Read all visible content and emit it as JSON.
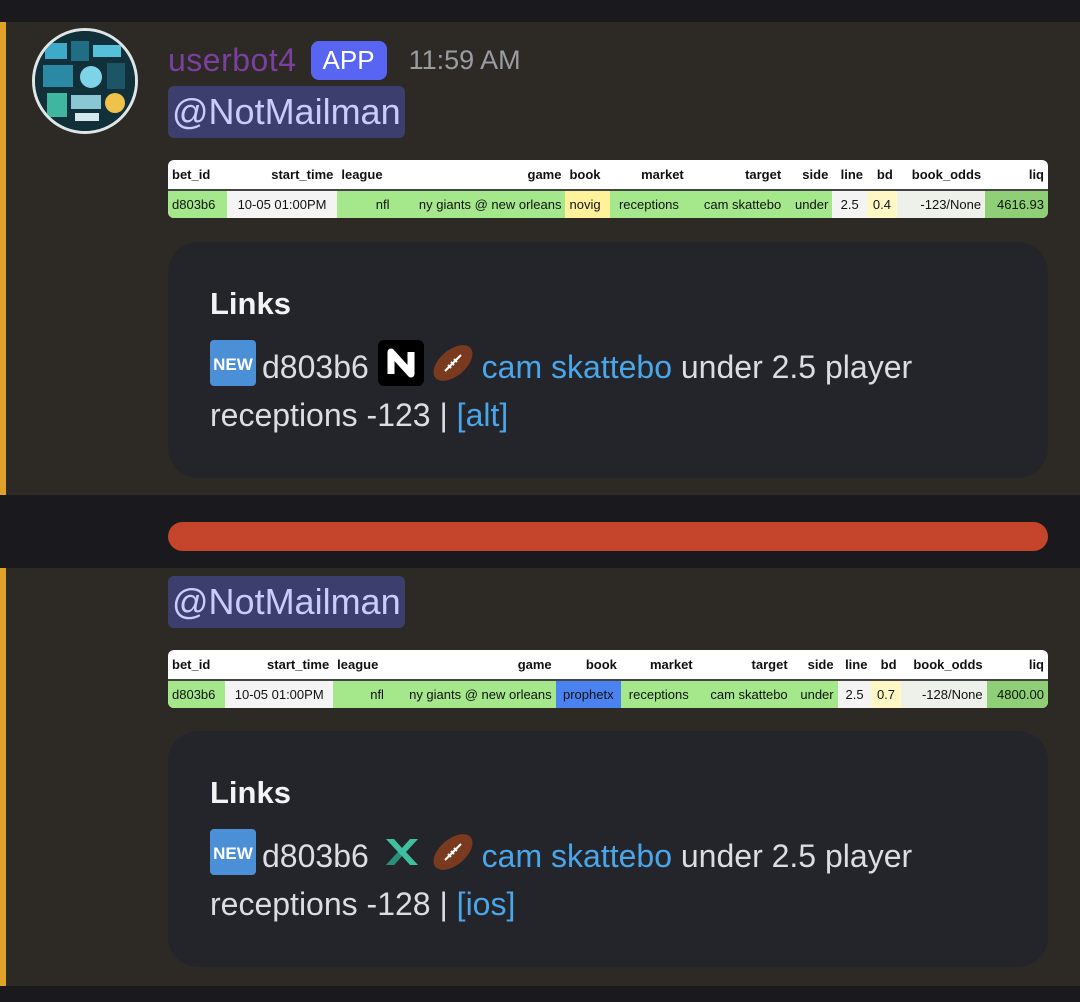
{
  "message1": {
    "username": "userbot4",
    "badge": "APP",
    "timestamp": "11:59 AM",
    "mention": "@NotMailman",
    "table": {
      "headers": [
        "bet_id",
        "start_time",
        "league",
        "game",
        "book",
        "market",
        "target",
        "side",
        "line",
        "bd",
        "book_odds",
        "liq"
      ],
      "row": [
        "d803b6",
        "10-05 01:00PM",
        "nfl",
        "ny giants @ new orleans",
        "novig",
        "receptions",
        "cam skattebo",
        "under",
        "2.5",
        "0.4",
        "-123/None",
        "4616.93"
      ]
    },
    "embed": {
      "title": "Links",
      "new_icon": "new-emoji-icon",
      "bet_id": "d803b6",
      "book_icon": "novig-logo-icon",
      "sport_icon": "american-football-icon",
      "player_link": "cam skattebo",
      "text1": " under 2.5 player",
      "text2": "receptions -123 | ",
      "alt_link": "[alt]"
    }
  },
  "divider_color": "#c4442c",
  "message2": {
    "mention": "@NotMailman",
    "table": {
      "headers": [
        "bet_id",
        "start_time",
        "league",
        "game",
        "book",
        "market",
        "target",
        "side",
        "line",
        "bd",
        "book_odds",
        "liq"
      ],
      "row": [
        "d803b6",
        "10-05 01:00PM",
        "nfl",
        "ny giants @ new orleans",
        "prophetx",
        "receptions",
        "cam skattebo",
        "under",
        "2.5",
        "0.7",
        "-128/None",
        "4800.00"
      ]
    },
    "embed": {
      "title": "Links",
      "new_icon": "new-emoji-icon",
      "bet_id": "d803b6",
      "book_icon": "prophetx-logo-icon",
      "sport_icon": "american-football-icon",
      "player_link": "cam skattebo",
      "text1": " under 2.5 player",
      "text2": "receptions -128 | ",
      "alt_link": "[ios]"
    }
  }
}
